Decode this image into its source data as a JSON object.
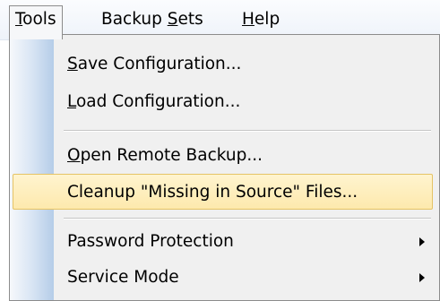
{
  "menubar": {
    "items": [
      {
        "pre": "",
        "acc": "T",
        "post": "ools"
      },
      {
        "pre": "Backup ",
        "acc": "S",
        "post": "ets"
      },
      {
        "pre": "",
        "acc": "H",
        "post": "elp"
      }
    ]
  },
  "tools_menu": {
    "items": [
      {
        "pre": "",
        "acc": "S",
        "post": "ave Configuration..."
      },
      {
        "pre": "",
        "acc": "L",
        "post": "oad Configuration..."
      },
      {
        "pre": "",
        "acc": "O",
        "post": "pen Remote Backup..."
      },
      {
        "pre": "Cleanup \"Missing in Source\" Files...",
        "acc": "",
        "post": ""
      },
      {
        "pre": "Password Protection",
        "acc": "",
        "post": ""
      },
      {
        "pre": "Service Mode",
        "acc": "",
        "post": ""
      }
    ]
  }
}
